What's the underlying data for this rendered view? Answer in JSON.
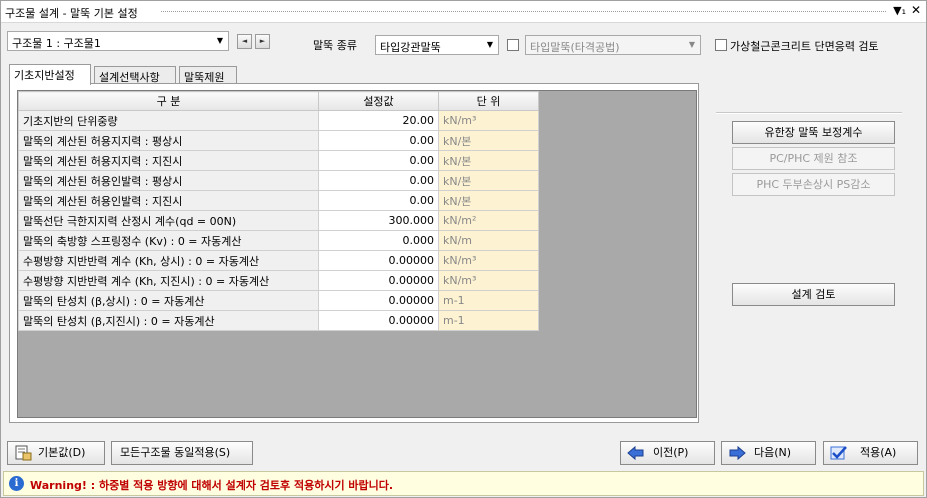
{
  "window": {
    "title": "구조물 설계 - 말뚝 기본 설정",
    "pin_icon": "pin-icon",
    "close_icon": "close-icon"
  },
  "structure_select": {
    "value": "구조물 1 : 구조물1"
  },
  "nav": {
    "prev_icon": "◄",
    "next_icon": "►"
  },
  "pile_type": {
    "label": "말뚝 종류",
    "value": "타입강관말뚝"
  },
  "method_select": {
    "value": "타입말뚝(타격공법)"
  },
  "virtual_rc_check": {
    "label": "가상철근콘크리트 단면응력 검토",
    "checked": false
  },
  "method_check": {
    "checked": false
  },
  "tabs": [
    {
      "label": "기초지반설정",
      "active": true
    },
    {
      "label": "설계선택사항",
      "active": false
    },
    {
      "label": "말뚝제원",
      "active": false
    }
  ],
  "table": {
    "headers": [
      "구 분",
      "설정값",
      "단 위"
    ],
    "rows": [
      {
        "name": "기초지반의 단위중량",
        "value": "20.00",
        "unit": "kN/m³"
      },
      {
        "name": "말뚝의 계산된 허용지지력 : 평상시",
        "value": "0.00",
        "unit": "kN/본"
      },
      {
        "name": "말뚝의 계산된 허용지지력 : 지진시",
        "value": "0.00",
        "unit": "kN/본"
      },
      {
        "name": "말뚝의 계산된 허용인발력 : 평상시",
        "value": "0.00",
        "unit": "kN/본"
      },
      {
        "name": "말뚝의 계산된 허용인발력 : 지진시",
        "value": "0.00",
        "unit": "kN/본"
      },
      {
        "name": "말뚝선단 극한지지력 산정시 계수(qd = 00N)",
        "value": "300.000",
        "unit": "kN/m²"
      },
      {
        "name": "말뚝의 축방향 스프링정수 (Kv) : 0 = 자동계산",
        "value": "0.000",
        "unit": "kN/m"
      },
      {
        "name": "수평방향 지반반력 계수 (Kh, 상시) : 0 = 자동계산",
        "value": "0.00000",
        "unit": "kN/m³"
      },
      {
        "name": "수평방향 지반반력 계수 (Kh, 지진시) : 0 = 자동계산",
        "value": "0.00000",
        "unit": "kN/m³"
      },
      {
        "name": "말뚝의 탄성치 (β,상시) : 0 = 자동계산",
        "value": "0.00000",
        "unit": "m-1"
      },
      {
        "name": "말뚝의 탄성치 (β,지진시) : 0 = 자동계산",
        "value": "0.00000",
        "unit": "m-1"
      }
    ]
  },
  "right_buttons": {
    "correction": "유한장 말뚝 보정계수",
    "phc_ref": "PC/PHC 제원 참조",
    "phc_ps": "PHC 두부손상시 PS감소",
    "design_check": "설계 검토"
  },
  "bottom_buttons": {
    "default": "기본값(D)",
    "apply_all": "모든구조물 동일적용(S)",
    "prev": "이전(P)",
    "next": "다음(N)",
    "apply": "적용(A)"
  },
  "warning": {
    "text": "Warning! : 하중별 적용 방향에 대해서 설계자 검토후 적용하시기 바랍니다."
  },
  "colors": {
    "warning_text": "#c00000",
    "unit_cell": "#fdf3d3",
    "grid_bg": "#a9a9a9"
  }
}
